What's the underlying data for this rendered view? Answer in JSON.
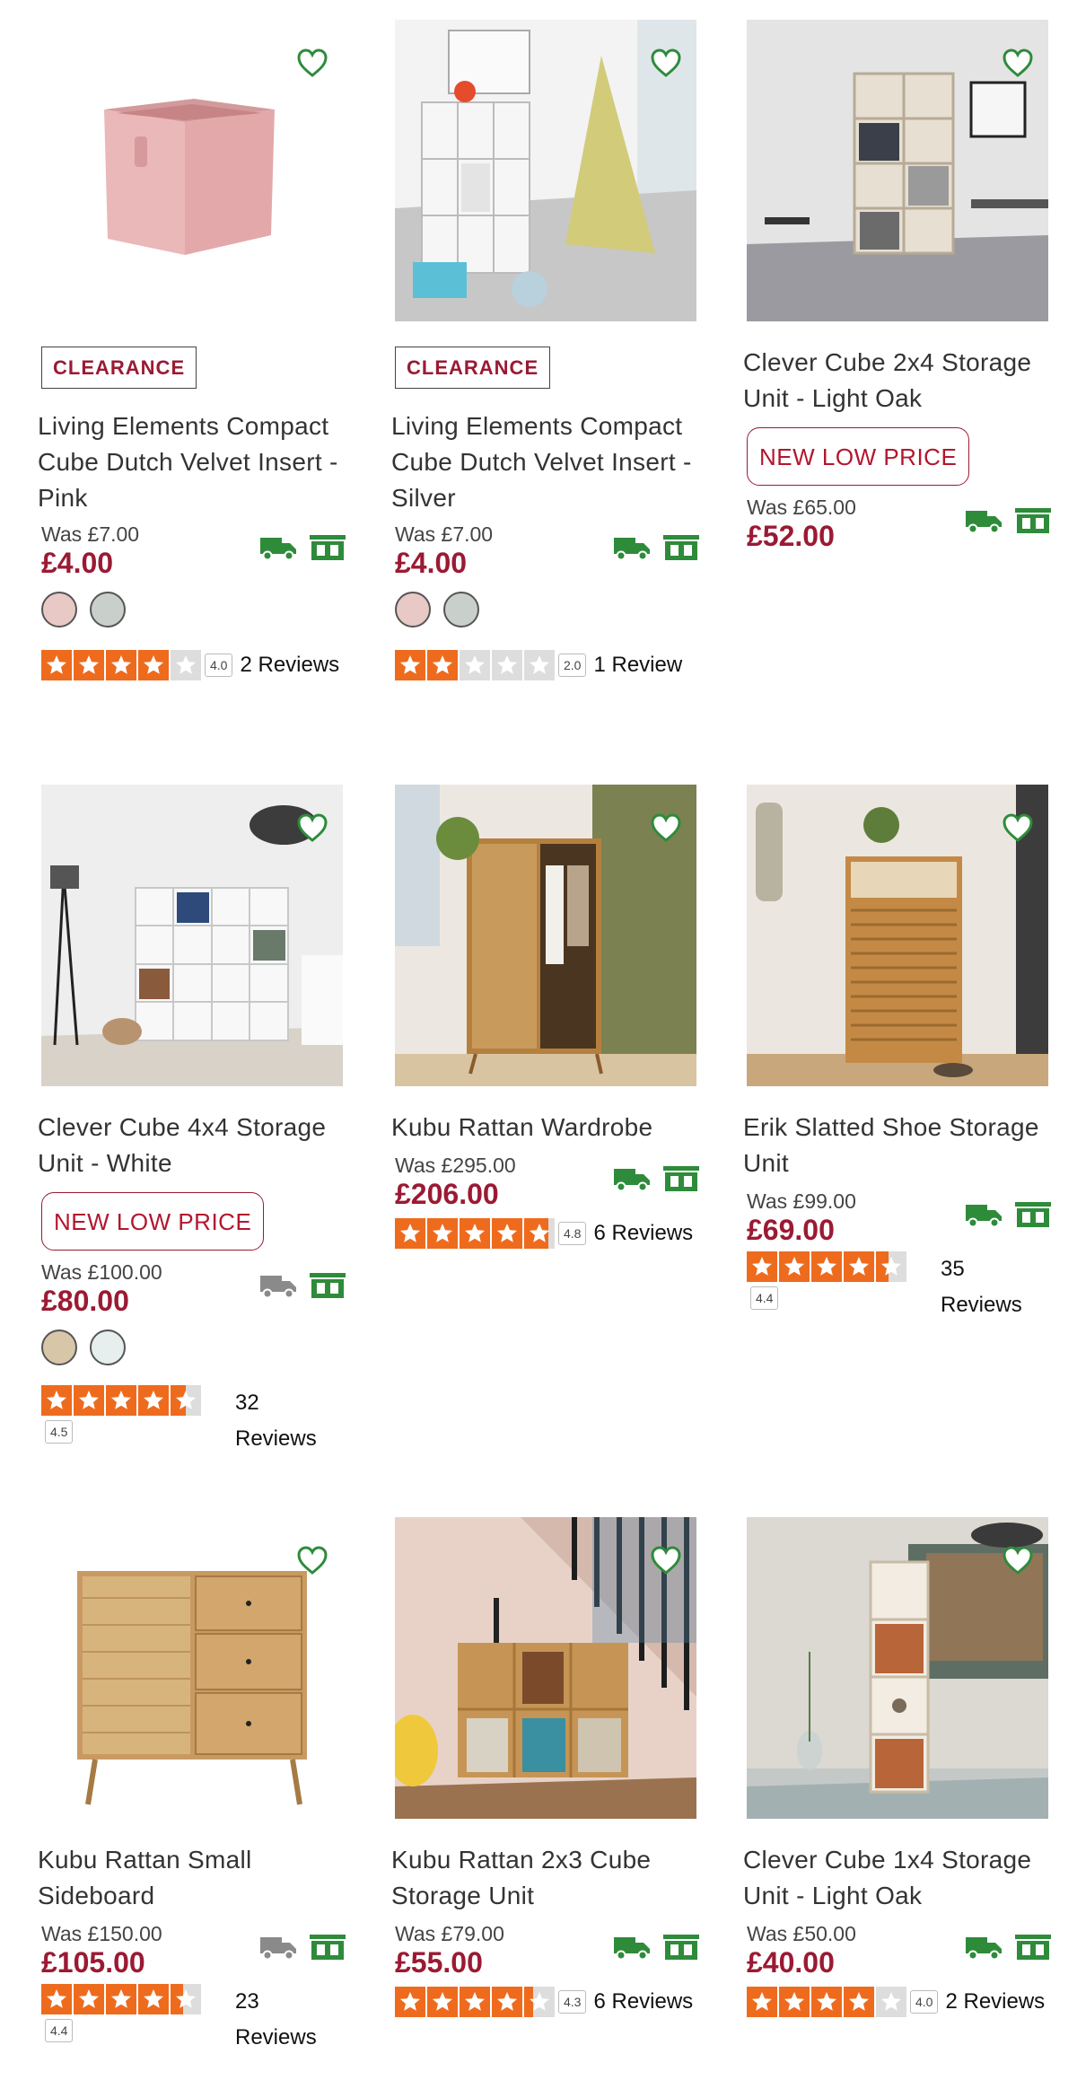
{
  "colors": {
    "price": "#9b1a33",
    "clearance_text": "#9b1a33",
    "new_low_price": "#b3162e",
    "star": "#ee6b1e",
    "star_empty": "#dddddd",
    "delivery_green": "#2e8b3a",
    "delivery_grey": "#8a8a8a",
    "heart": "#2e8b3a"
  },
  "products": [
    {
      "title": "Living Elements Compact Cube Dutch Velvet Insert - Pink",
      "badge": "CLEARANCE",
      "was": "Was £7.00",
      "now": "£4.00",
      "swatches": [
        "#e8c9c6",
        "#c9cfca"
      ],
      "rating": 4.0,
      "score": "4.0",
      "reviews": "2 Reviews",
      "delivery_icon": "truck-green-icon",
      "image_icon": "pink-storage-cube"
    },
    {
      "title": "Living Elements Compact Cube Dutch Velvet Insert - Silver",
      "badge": "CLEARANCE",
      "was": "Was £7.00",
      "now": "£4.00",
      "swatches": [
        "#e8c9c6",
        "#c9cfca"
      ],
      "rating": 2.0,
      "score": "2.0",
      "reviews": "1 Review",
      "delivery_icon": "truck-green-icon",
      "image_icon": "kids-room-cube-unit"
    },
    {
      "title": "Clever Cube 2x4 Storage Unit - Light Oak",
      "badge": "NEW LOW PRICE",
      "was": "Was £65.00",
      "now": "£52.00",
      "rating": null,
      "delivery_icon": "truck-green-icon",
      "image_icon": "oak-cube-unit-room"
    },
    {
      "title": "Clever Cube 4x4 Storage Unit - White",
      "badge": "NEW LOW PRICE",
      "was": "Was £100.00",
      "now": "£80.00",
      "swatches": [
        "#d8c6a8",
        "#e6eeee"
      ],
      "rating": 4.5,
      "score": "4.5",
      "reviews_num": "32",
      "reviews_word": "Reviews",
      "delivery_icon": "truck-grey-icon",
      "image_icon": "white-cube-unit-room"
    },
    {
      "title": "Kubu Rattan Wardrobe",
      "was": "Was £295.00",
      "now": "£206.00",
      "rating": 4.8,
      "score": "4.8",
      "reviews": "6 Reviews",
      "delivery_icon": "truck-green-icon",
      "image_icon": "rattan-wardrobe-room"
    },
    {
      "title": "Erik Slatted Shoe Storage Unit",
      "was": "Was £99.00",
      "now": "£69.00",
      "rating": 4.4,
      "score": "4.4",
      "reviews_num": "35",
      "reviews_word": "Reviews",
      "delivery_icon": "truck-green-icon",
      "image_icon": "shoe-storage-room"
    },
    {
      "title": "Kubu Rattan Small Sideboard",
      "was": "Was £150.00",
      "now": "£105.00",
      "rating": 4.4,
      "score": "4.4",
      "reviews_num": "23",
      "reviews_word": "Reviews",
      "delivery_icon": "truck-grey-icon",
      "image_icon": "rattan-sideboard"
    },
    {
      "title": "Kubu Rattan 2x3 Cube Storage Unit",
      "was": "Was £79.00",
      "now": "£55.00",
      "rating": 4.3,
      "score": "4.3",
      "reviews": "6 Reviews",
      "delivery_icon": "truck-green-icon",
      "image_icon": "rattan-cube-unit-stairs"
    },
    {
      "title": "Clever Cube 1x4 Storage Unit - Light Oak",
      "was": "Was £50.00",
      "now": "£40.00",
      "rating": 4.0,
      "score": "4.0",
      "reviews": "2 Reviews",
      "delivery_icon": "truck-green-icon",
      "image_icon": "tall-cube-unit-room"
    }
  ]
}
